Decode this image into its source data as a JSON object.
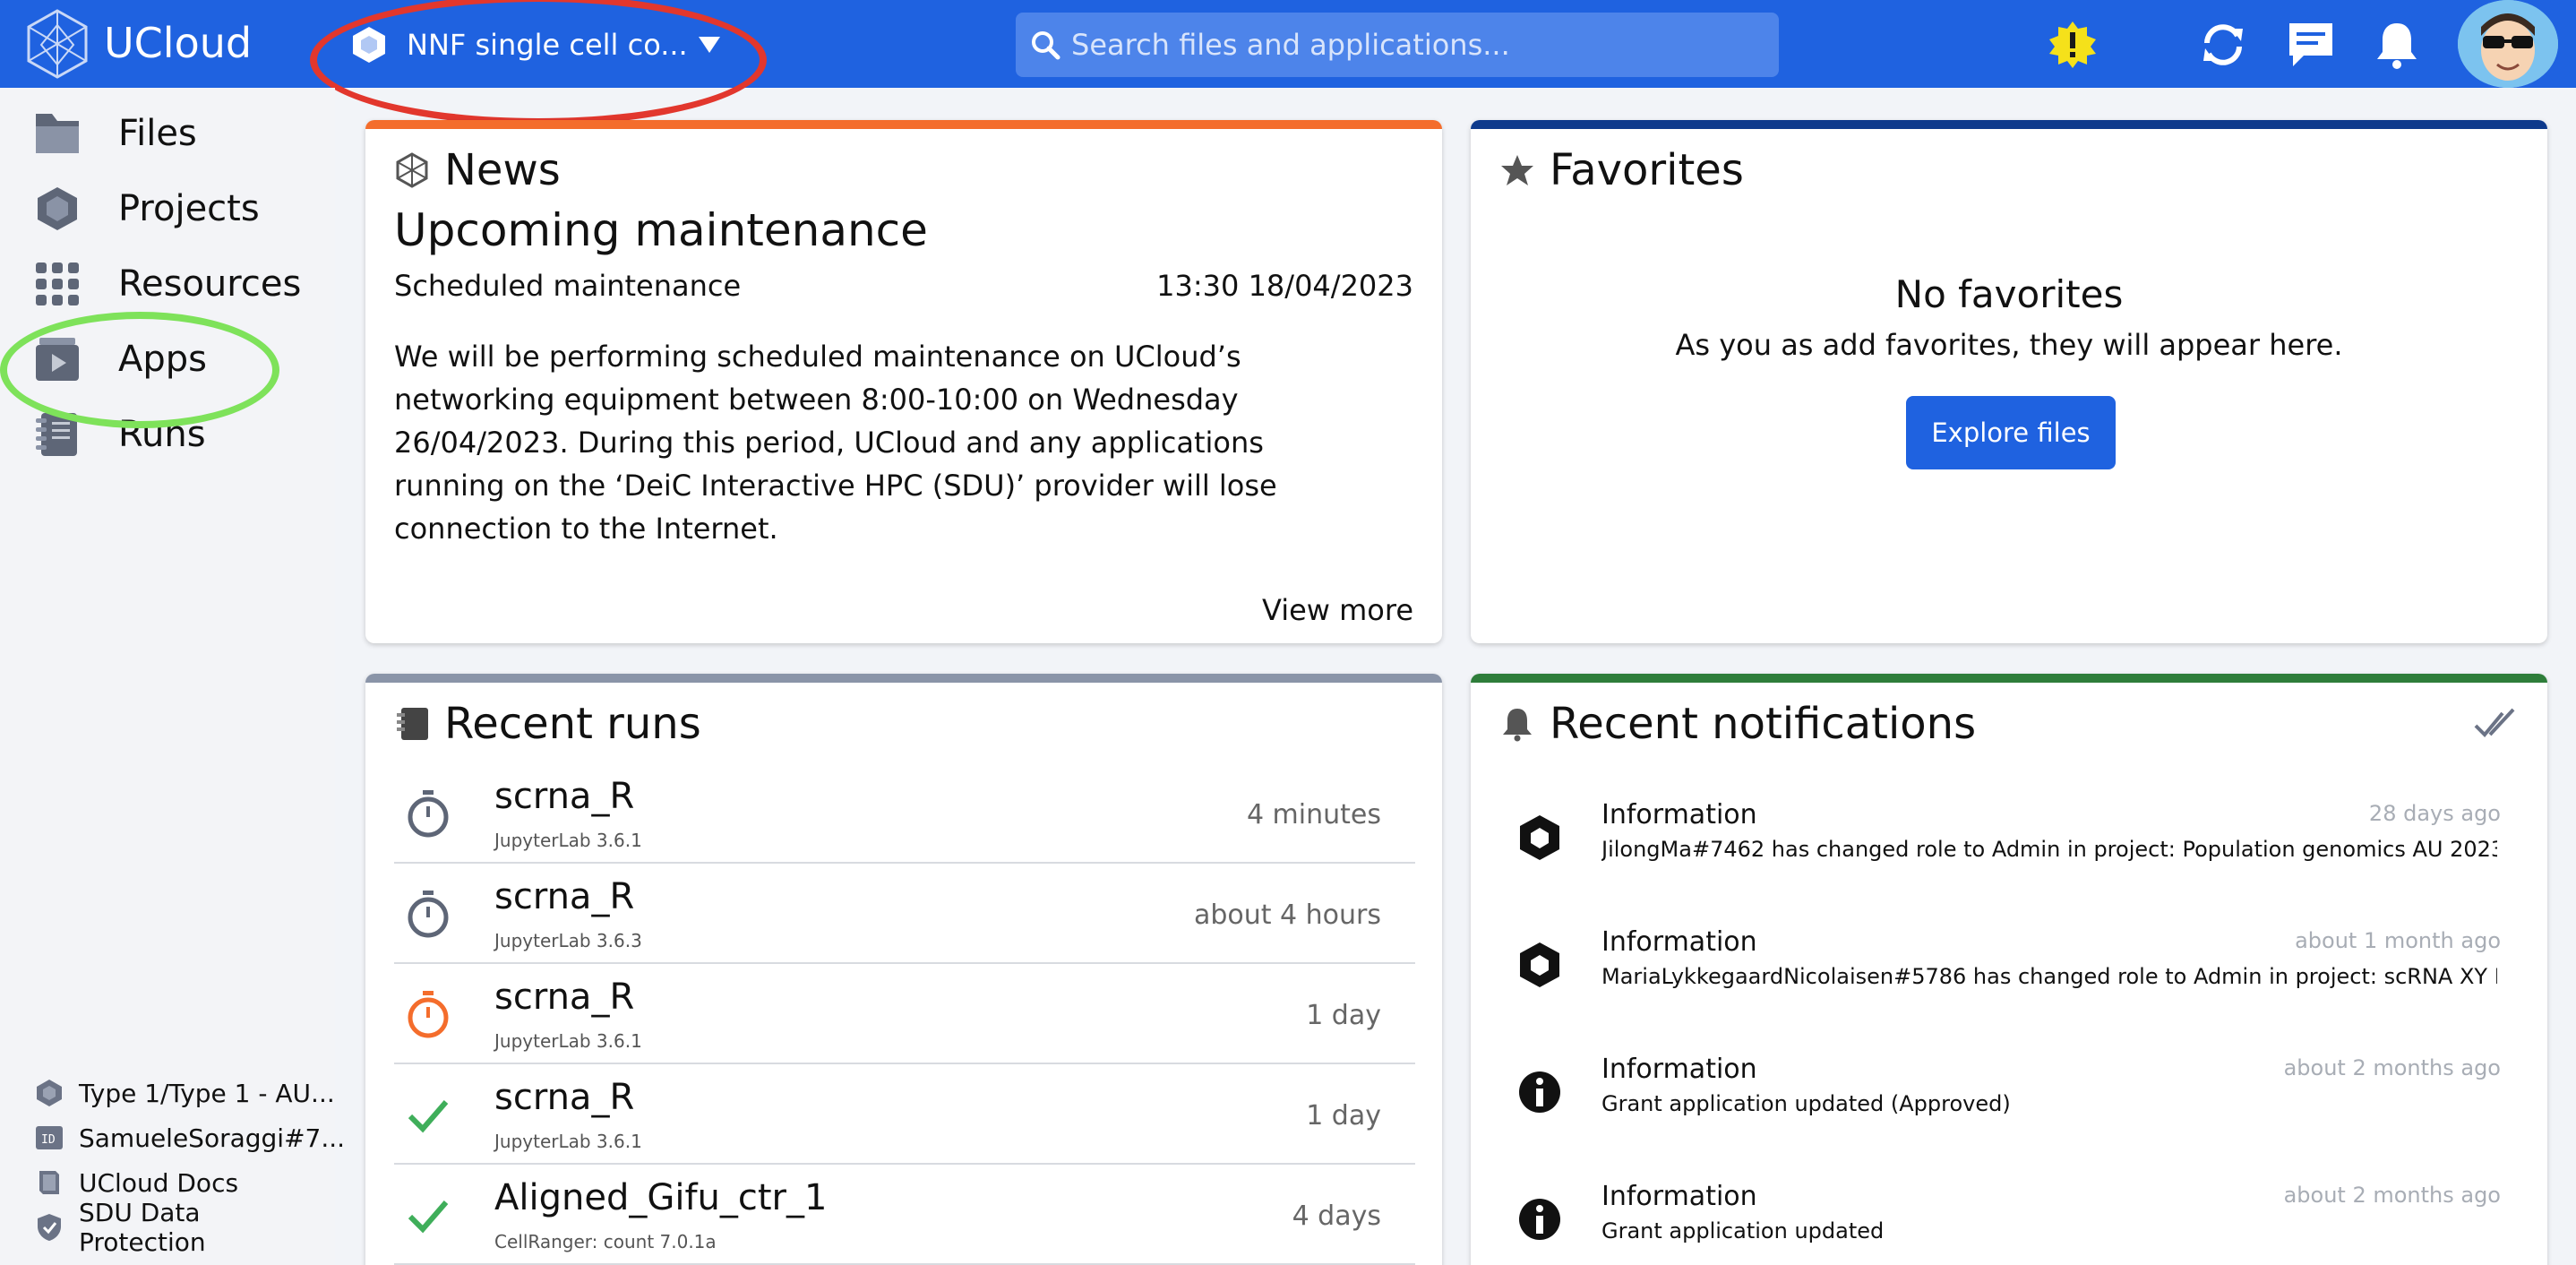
{
  "header": {
    "brand": "UCloud",
    "project_selector": "NNF single cell co...",
    "search_placeholder": "Search files and applications..."
  },
  "sidebar": {
    "items": [
      {
        "label": "Files",
        "icon": "folder-icon"
      },
      {
        "label": "Projects",
        "icon": "hexagon-icon"
      },
      {
        "label": "Resources",
        "icon": "grid-icon"
      },
      {
        "label": "Apps",
        "icon": "app-window-icon"
      },
      {
        "label": "Runs",
        "icon": "notebook-icon"
      }
    ],
    "footer": [
      {
        "label": "Type 1/Type 1 - AU...",
        "icon": "hexagon-icon"
      },
      {
        "label": "SamueleSoraggi#7...",
        "icon": "id-card-icon"
      },
      {
        "label": "UCloud Docs",
        "icon": "book-icon"
      },
      {
        "label": "SDU Data Protection",
        "icon": "shield-icon"
      }
    ]
  },
  "news": {
    "title": "News",
    "headline": "Upcoming maintenance",
    "subtitle": "Scheduled maintenance",
    "date": "13:30 18/04/2023",
    "body": "We will be performing scheduled maintenance on UCloud’s networking equipment between 8:00-10:00 on Wednesday 26/04/2023. During this period, UCloud and any applications running on the ‘DeiC Interactive HPC (SDU)’ provider will lose connection to the Internet.",
    "view_more": "View more",
    "accent": "#f46d2c"
  },
  "favorites": {
    "title": "Favorites",
    "empty_title": "No favorites",
    "empty_sub": "As you as add favorites, they will appear here.",
    "button": "Explore files",
    "accent": "#0e3a8c"
  },
  "runs": {
    "title": "Recent runs",
    "accent": "#8a94a8",
    "items": [
      {
        "name": "scrna_R",
        "app": "JupyterLab 3.6.1",
        "time": "4 minutes",
        "status": "running"
      },
      {
        "name": "scrna_R",
        "app": "JupyterLab 3.6.3",
        "time": "about 4 hours",
        "status": "running"
      },
      {
        "name": "scrna_R",
        "app": "JupyterLab 3.6.1",
        "time": "1 day",
        "status": "expiring"
      },
      {
        "name": "scrna_R",
        "app": "JupyterLab 3.6.1",
        "time": "1 day",
        "status": "success"
      },
      {
        "name": "Aligned_Gifu_ctr_1",
        "app": "CellRanger: count 7.0.1a",
        "time": "4 days",
        "status": "success"
      }
    ]
  },
  "notifications": {
    "title": "Recent notifications",
    "accent": "#2e7d3a",
    "items": [
      {
        "title": "Information",
        "message": "JilongMa#7462 has changed role to Admin in project: Population genomics AU 2023",
        "time": "28 days ago",
        "icon": "hexagon-icon"
      },
      {
        "title": "Information",
        "message": "MariaLykkegaardNicolaisen#5786 has changed role to Admin in project: scRNA XY Prima...",
        "time": "about 1 month ago",
        "icon": "hexagon-icon"
      },
      {
        "title": "Information",
        "message": "Grant application updated (Approved)",
        "time": "about 2 months ago",
        "icon": "info-icon"
      },
      {
        "title": "Information",
        "message": "Grant application updated",
        "time": "about 2 months ago",
        "icon": "info-icon"
      }
    ]
  }
}
